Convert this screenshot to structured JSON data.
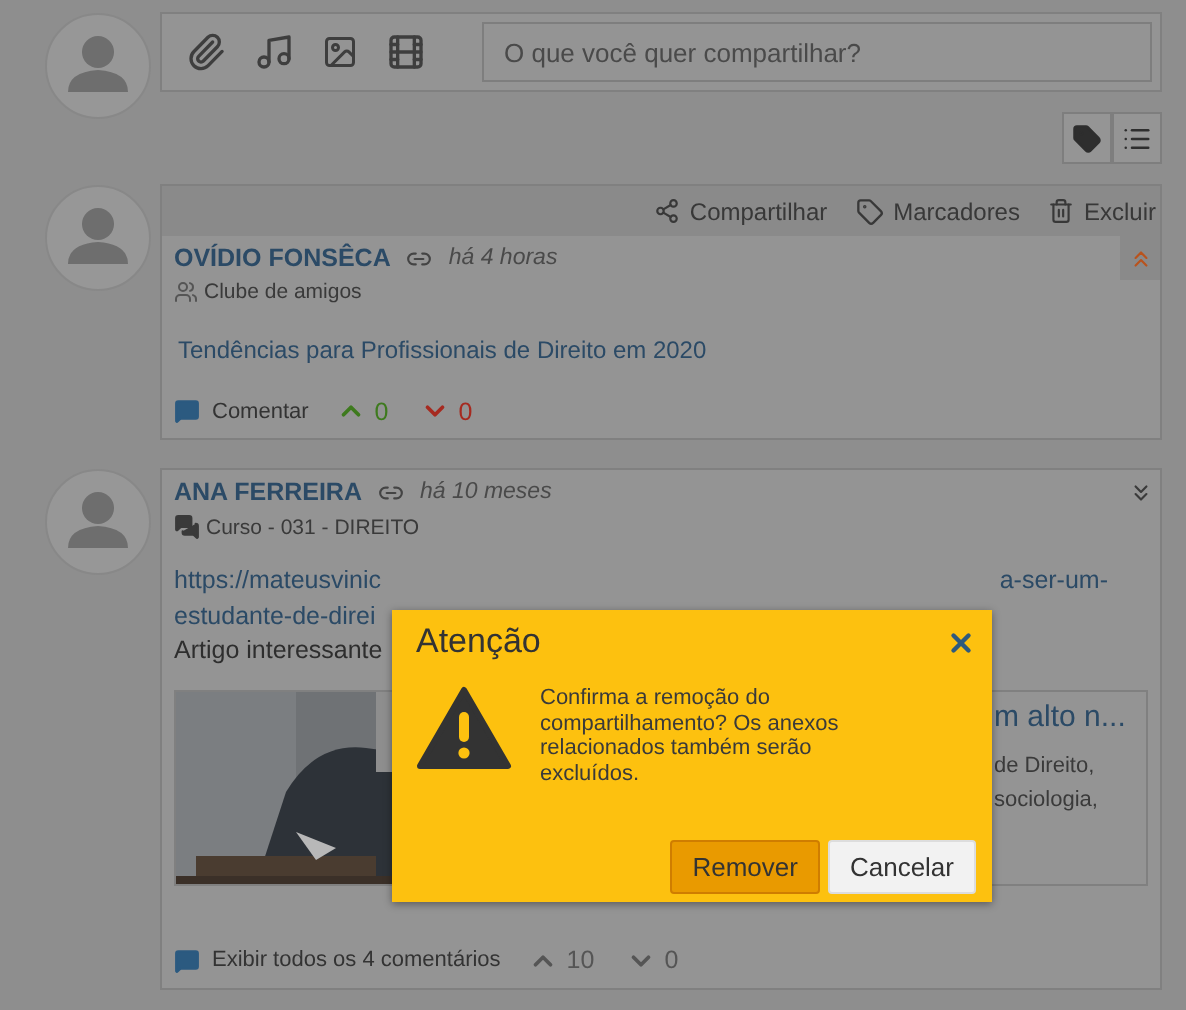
{
  "composer": {
    "placeholder": "O que você quer compartilhar?"
  },
  "posts": [
    {
      "actions": [
        {
          "label": "Compartilhar",
          "kind": "share"
        },
        {
          "label": "Marcadores",
          "kind": "tags"
        },
        {
          "label": "Excluir",
          "kind": "delete"
        }
      ],
      "author": "OVÍDIO FONSÊCA",
      "time": "há 4 horas",
      "group": {
        "label": "Clube de amigos",
        "kind": "club"
      },
      "expanded": true,
      "text": "Tendências para Profissionais de Direito em 2020",
      "comment_label": "Comentar",
      "up": "0",
      "down": "0",
      "votes_active": true
    },
    {
      "author": "ANA FERREIRA",
      "time": "há 10 meses",
      "group": {
        "label": "Curso - 031 - DIREITO",
        "kind": "course"
      },
      "expanded": false,
      "body": [
        {
          "left": "https://mateusvinic",
          "right": "a-ser-um-",
          "kind": "link"
        },
        {
          "left": "estudante-de-direi",
          "kind": "link"
        },
        {
          "left": "Artigo interessante",
          "kind": "plain"
        }
      ],
      "preview": {
        "kind": "picture",
        "title": "m alto n...",
        "description": [
          "de Direito,",
          "sociologia,"
        ]
      },
      "comment_label": "Exibir todos os 4 comentários",
      "up": "10",
      "down": "0",
      "votes_active": false
    }
  ],
  "dialog": {
    "title": "Atenção",
    "message": "Confirma a remoção do compartilhamento? Os anexos relacionados também serão excluídos.",
    "buttons": [
      {
        "label": "Remover",
        "primary": true
      },
      {
        "label": "Cancelar",
        "primary": false
      }
    ]
  }
}
